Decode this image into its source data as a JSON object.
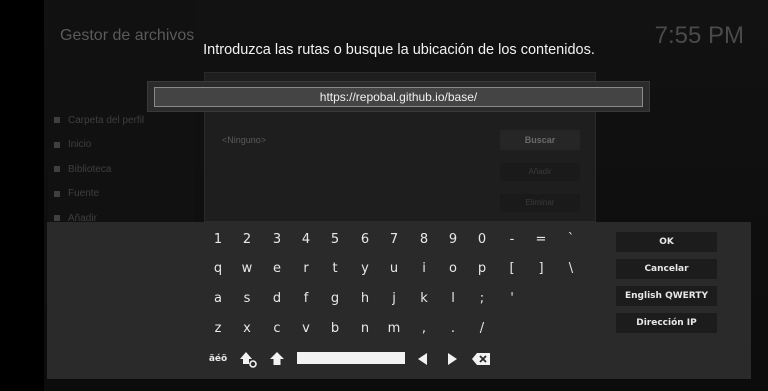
{
  "background": {
    "title": "Gestor de archivos",
    "clock": "7:55 PM",
    "sidebar": [
      "Carpeta del perfil",
      "Inicio",
      "Biblioteca",
      "Fuente",
      "Añadir"
    ],
    "dialog_row": "<Ninguno>",
    "browse_label": "Buscar",
    "buttons": [
      "Añadir",
      "Eliminar"
    ]
  },
  "dialog": {
    "heading": "Introduzca las rutas o busque la ubicación de los contenidos.",
    "input_value": "https://repobal.github.io/base/"
  },
  "keyboard": {
    "row1": [
      "1",
      "2",
      "3",
      "4",
      "5",
      "6",
      "7",
      "8",
      "9",
      "0",
      "-",
      "=",
      "`"
    ],
    "row2": [
      "q",
      "w",
      "e",
      "r",
      "t",
      "y",
      "u",
      "i",
      "o",
      "p",
      "[",
      "]",
      "\\"
    ],
    "row3": [
      "a",
      "s",
      "d",
      "f",
      "g",
      "h",
      "j",
      "k",
      "l",
      ";",
      "'"
    ],
    "row4": [
      "z",
      "x",
      "c",
      "v",
      "b",
      "n",
      "m",
      ",",
      ".",
      "/"
    ],
    "symbols_label": "äéö"
  },
  "side_buttons": {
    "ok": "OK",
    "cancel": "Cancelar",
    "layout": "English QWERTY",
    "ip": "Dirección IP"
  }
}
